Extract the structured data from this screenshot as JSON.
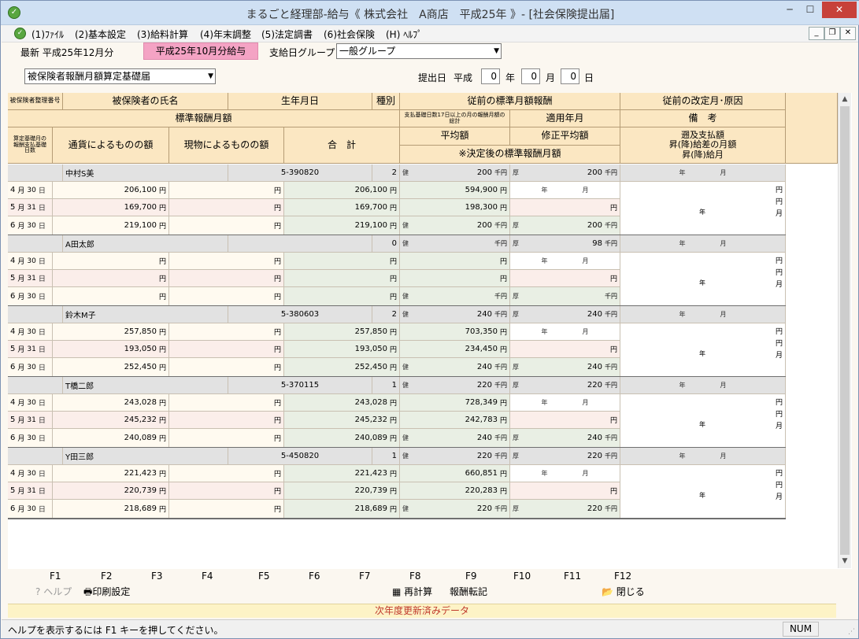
{
  "window": {
    "title": "まるごと経理部-給与《 株式会社　A商店　平成25年 》- [社会保険提出届]"
  },
  "menu": [
    "(1)ﾌｧｲﾙ",
    "(2)基本設定",
    "(3)給料計算",
    "(4)年末調整",
    "(5)法定調書",
    "(6)社会保険",
    "(H) ﾍﾙﾌﾟ"
  ],
  "info": {
    "latest": "最新 平成25年12月分",
    "payroll_month": "平成25年10月分給与",
    "group_label": "支給日グループ",
    "group_value": "一般グループ",
    "form_select": "被保険者報酬月額算定基礎届",
    "submit_label": "提出日",
    "era": "平成",
    "year_value": "0",
    "year_label": "年",
    "month_value": "0",
    "month_label": "月",
    "day_value": "0",
    "day_label": "日"
  },
  "headers": {
    "insured_no": "被保険者整理番号",
    "name": "被保険者の氏名",
    "birth": "生年月日",
    "kind": "種別",
    "prev_std": "従前の標準月額報酬",
    "prev_revision": "従前の改定月･原因",
    "std_monthly": "標準報酬月額",
    "days17": "支払基礎日数17日以上の月の報酬月額の総計",
    "apply_month": "適用年月",
    "remarks": "備　考",
    "calc_days": "算定基礎月の報酬支払基礎日数",
    "currency": "通貨によるものの額",
    "in_kind": "現物によるものの額",
    "total": "合　計",
    "average": "平均額",
    "adj_average": "修正平均額",
    "decided": "※決定後の標準報酬月額",
    "retro": "遡及支払額",
    "diff_month": "昇(降)給差の月額",
    "raise": "昇(降)給月"
  },
  "labels": {
    "yen": "円",
    "sen": "千円",
    "ki": "健",
    "ko": "厚",
    "nen": "年",
    "tsuki": "月",
    "hi": "日"
  },
  "employees": [
    {
      "name": "中村S美",
      "birth": "5-390820",
      "kind": "2",
      "prev_ki": "200",
      "prev_ko": "200",
      "months": [
        {
          "m": "4",
          "d": "30",
          "cur": "206,100",
          "kind": "",
          "tot": "206,100"
        },
        {
          "m": "5",
          "d": "31",
          "cur": "169,700",
          "kind": "",
          "tot": "169,700"
        },
        {
          "m": "6",
          "d": "30",
          "cur": "219,100",
          "kind": "",
          "tot": "219,100"
        }
      ],
      "sum": "594,900",
      "avg": "198,300",
      "dec_ki": "200",
      "dec_ko": "200"
    },
    {
      "name": "A田太郎",
      "birth": "",
      "kind": "0",
      "prev_ki": "",
      "prev_ko": "98",
      "months": [
        {
          "m": "4",
          "d": "30",
          "cur": "",
          "kind": "",
          "tot": ""
        },
        {
          "m": "5",
          "d": "31",
          "cur": "",
          "kind": "",
          "tot": ""
        },
        {
          "m": "6",
          "d": "30",
          "cur": "",
          "kind": "",
          "tot": ""
        }
      ],
      "sum": "",
      "avg": "",
      "dec_ki": "",
      "dec_ko": ""
    },
    {
      "name": "鈴木M子",
      "birth": "5-380603",
      "kind": "2",
      "prev_ki": "240",
      "prev_ko": "240",
      "months": [
        {
          "m": "4",
          "d": "30",
          "cur": "257,850",
          "kind": "",
          "tot": "257,850"
        },
        {
          "m": "5",
          "d": "31",
          "cur": "193,050",
          "kind": "",
          "tot": "193,050"
        },
        {
          "m": "6",
          "d": "30",
          "cur": "252,450",
          "kind": "",
          "tot": "252,450"
        }
      ],
      "sum": "703,350",
      "avg": "234,450",
      "dec_ki": "240",
      "dec_ko": "240"
    },
    {
      "name": "T橋二郎",
      "birth": "5-370115",
      "kind": "1",
      "prev_ki": "220",
      "prev_ko": "220",
      "months": [
        {
          "m": "4",
          "d": "30",
          "cur": "243,028",
          "kind": "",
          "tot": "243,028"
        },
        {
          "m": "5",
          "d": "31",
          "cur": "245,232",
          "kind": "",
          "tot": "245,232"
        },
        {
          "m": "6",
          "d": "30",
          "cur": "240,089",
          "kind": "",
          "tot": "240,089"
        }
      ],
      "sum": "728,349",
      "avg": "242,783",
      "dec_ki": "240",
      "dec_ko": "240"
    },
    {
      "name": "Y田三郎",
      "birth": "5-450820",
      "kind": "1",
      "prev_ki": "220",
      "prev_ko": "220",
      "months": [
        {
          "m": "4",
          "d": "30",
          "cur": "221,423",
          "kind": "",
          "tot": "221,423"
        },
        {
          "m": "5",
          "d": "31",
          "cur": "220,739",
          "kind": "",
          "tot": "220,739"
        },
        {
          "m": "6",
          "d": "30",
          "cur": "218,689",
          "kind": "",
          "tot": "218,689"
        }
      ],
      "sum": "660,851",
      "avg": "220,283",
      "dec_ki": "220",
      "dec_ko": "220"
    }
  ],
  "fkeys": [
    "F1",
    "F2",
    "F3",
    "F4",
    "F5",
    "F6",
    "F7",
    "F8",
    "F9",
    "F10",
    "F11",
    "F12"
  ],
  "fbuttons": {
    "help": "ヘルプ",
    "print": "印刷設定",
    "recalc": "再計算",
    "transfer": "報酬転記",
    "close": "閉じる"
  },
  "status_note": "次年度更新済みデータ",
  "status": {
    "text": "ヘルプを表示するには F1 キーを押してください。",
    "num": "NUM"
  }
}
